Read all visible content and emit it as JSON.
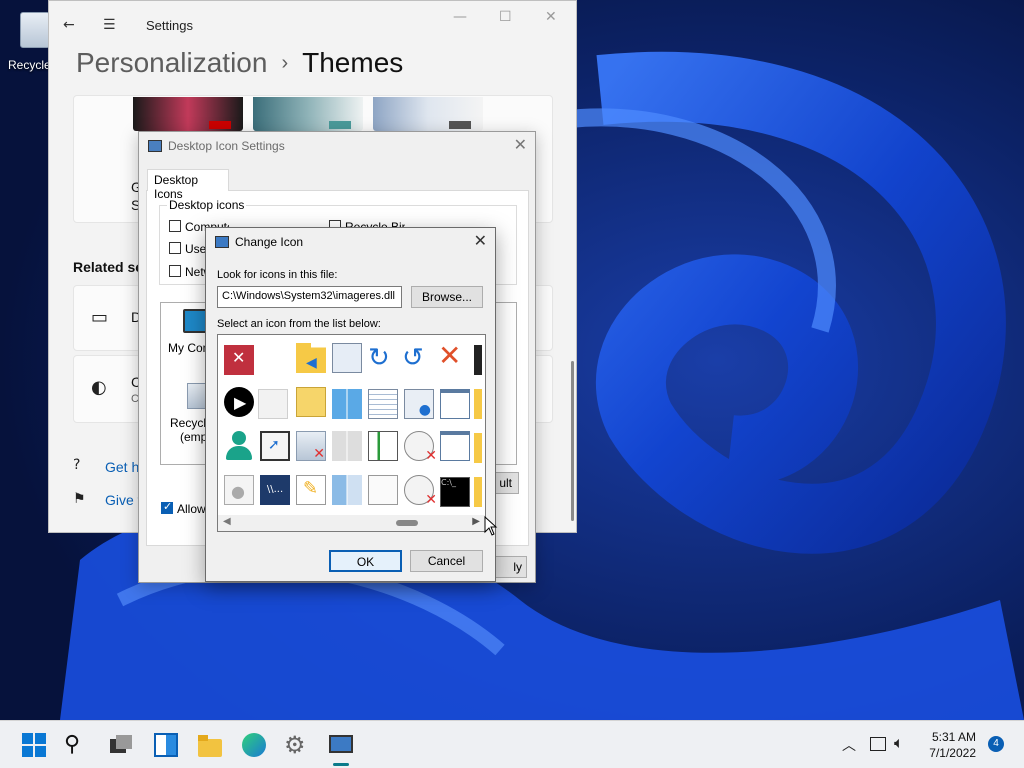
{
  "desktop": {
    "recycle_bin_label": "Recycle"
  },
  "settings": {
    "window_title": "Settings",
    "breadcrumb": {
      "parent": "Personalization",
      "separator": "›",
      "current": "Themes"
    },
    "related_label": "Related se",
    "card_partial_1": "G",
    "card_partial_2": "S",
    "row_1": "D",
    "row_2": "C",
    "row_2_sub": "C",
    "get_help": "Get h",
    "give_feedback": "Give f"
  },
  "desktop_icon_settings": {
    "title": "Desktop Icon Settings",
    "tab": "Desktop Icons",
    "group_label": "Desktop icons",
    "checkboxes": [
      {
        "label": "Computer",
        "checked": false
      },
      {
        "label": "User",
        "checked": false
      },
      {
        "label": "Netw",
        "checked": false
      },
      {
        "label": "Recycle Bin",
        "checked": false
      }
    ],
    "icon_my_computer": "My Comp",
    "icon_recycle_1": "Recycle",
    "icon_recycle_2": "(empt",
    "default_btn_partial": "ult",
    "allow_themes": "Allow t",
    "apply_partial": "ly"
  },
  "change_icon": {
    "title": "Change Icon",
    "look_label": "Look for icons in this file:",
    "path_value": "C:\\Windows\\System32\\imageres.dll",
    "browse": "Browse...",
    "select_label": "Select an icon from the list below:",
    "ok": "OK",
    "cancel": "Cancel"
  },
  "taskbar": {
    "time": "5:31 AM",
    "date": "7/1/2022",
    "notification_count": "4",
    "icons": [
      "start-icon",
      "search-icon",
      "task-view-icon",
      "widgets-icon",
      "file-explorer-icon",
      "edge-icon",
      "settings-icon",
      "desktop-icon-settings-icon"
    ]
  },
  "colors": {
    "accent": "#0a5fb4",
    "wallpaper": "#0a1a4d",
    "taskbar": "#eef0f3"
  }
}
